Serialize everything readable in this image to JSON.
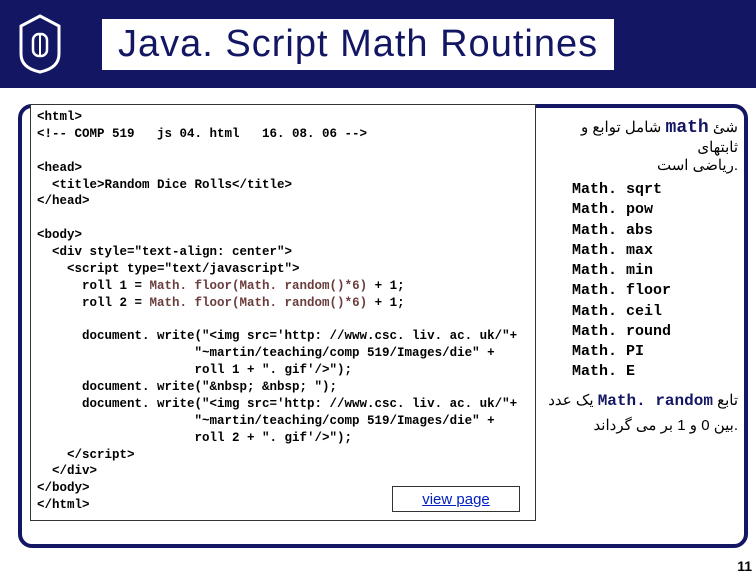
{
  "title": "Java. Script Math Routines",
  "code_lines": [
    "<html>",
    "<!-- COMP 519   js 04. html   16. 08. 06 -->",
    "",
    "<head>",
    "  <title>Random Dice Rolls</title>",
    "</head>",
    "",
    "<body>",
    "  <div style=\"text-align: center\">",
    "    <script type=\"text/javascript\">"
  ],
  "roll1_prefix": "      roll 1 = ",
  "roll1_hl": "Math. floor(Math. random()*6)",
  "roll1_suffix": " + 1;",
  "roll2_prefix": "      roll 2 = ",
  "roll2_hl": "Math. floor(Math. random()*6)",
  "roll2_suffix": " + 1;",
  "code_lines2": [
    "",
    "      document. write(\"<img src='http: //www.csc. liv. ac. uk/\"+",
    "                     \"~martin/teaching/comp 519/Images/die\" +",
    "                     roll 1 + \". gif'/>\");",
    "      document. write(\"&nbsp; &nbsp; \");",
    "      document. write(\"<img src='http: //www.csc. liv. ac. uk/\"+",
    "                     \"~martin/teaching/comp 519/Images/die\" +",
    "                     roll 2 + \". gif'/>\");",
    "    </script>",
    "  </div>",
    "</body>",
    "</html>"
  ],
  "view_link": "view page",
  "side": {
    "intro_fa": "شئ",
    "math_word": "math",
    "intro_fa2": "شامل توابع و ثابتهای",
    "intro_fa3": ".ریاضی است",
    "list": [
      "Math. sqrt",
      "Math. pow",
      "Math. abs",
      "Math. max",
      "Math. min",
      "Math. floor",
      "Math. ceil",
      "Math. round",
      "Math. PI",
      "Math. E"
    ],
    "random_fa1": "تابع",
    "random_code": "Math. random",
    "random_fa2": "یک عدد",
    "random_fa3": ".بین 0 و 1 بر می گرداند"
  },
  "page_number": "11"
}
